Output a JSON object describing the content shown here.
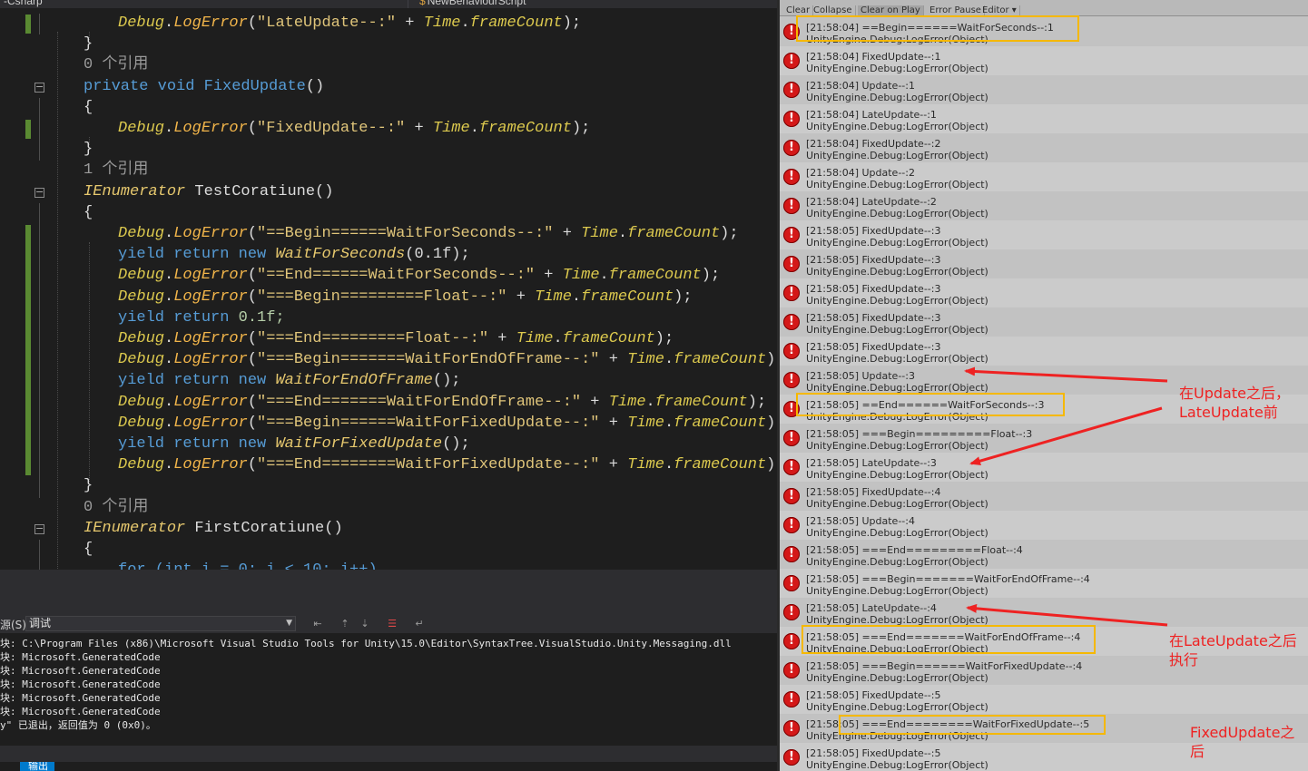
{
  "editor": {
    "tabs": [
      {
        "label": "-Csharp"
      },
      {
        "label": "NewBehaviourScript",
        "glyph": "$"
      }
    ],
    "lines": [
      {
        "kind": "call",
        "str": "\"LateUpdate--:\""
      },
      {
        "kind": "close"
      },
      {
        "kind": "ref",
        "text": "0 个引用"
      },
      {
        "kind": "sig",
        "mod": "private void",
        "name": "FixedUpdate",
        "rest": "()"
      },
      {
        "kind": "open"
      },
      {
        "kind": "call",
        "str": "\"FixedUpdate--:\""
      },
      {
        "kind": "close"
      },
      {
        "kind": "ref",
        "text": "1 个引用"
      },
      {
        "kind": "sig",
        "type": "IEnumerator",
        "name": "TestCoratiune",
        "rest": "()"
      },
      {
        "kind": "open"
      },
      {
        "kind": "call",
        "str": "\"==Begin======WaitForSeconds--:\""
      },
      {
        "kind": "yield",
        "kw": "yield return new",
        "type": "WaitForSeconds",
        "arg": "(0.1f);"
      },
      {
        "kind": "call",
        "str": "\"==End======WaitForSeconds--:\""
      },
      {
        "kind": "call",
        "str": "\"===Begin=========Float--:\""
      },
      {
        "kind": "yieldval",
        "kw": "yield return",
        "val": "0.1f;"
      },
      {
        "kind": "call",
        "str": "\"===End=========Float--:\""
      },
      {
        "kind": "call",
        "str": "\"===Begin=======WaitForEndOfFrame--:\""
      },
      {
        "kind": "yield",
        "kw": "yield return new",
        "type": "WaitForEndOfFrame",
        "arg": "();"
      },
      {
        "kind": "call",
        "str": "\"===End=======WaitForEndOfFrame--:\""
      },
      {
        "kind": "call",
        "str": "\"===Begin======WaitForFixedUpdate--:\""
      },
      {
        "kind": "yield",
        "kw": "yield return new",
        "type": "WaitForFixedUpdate",
        "arg": "();"
      },
      {
        "kind": "call",
        "str": "\"===End========WaitForFixedUpdate--:\""
      },
      {
        "kind": "close"
      },
      {
        "kind": "ref",
        "text": "0 个引用"
      },
      {
        "kind": "sig",
        "type": "IEnumerator",
        "name": "FirstCoratiune",
        "rest": "()"
      },
      {
        "kind": "open"
      },
      {
        "kind": "for",
        "text": "for (int i = 0; i < 10; i++)"
      }
    ],
    "tokens": {
      "debug": "Debug",
      "logerror": "LogError",
      "time": "Time",
      "framecount": "frameCount",
      "plus": " + ",
      "tail": ");",
      "open_brace": "{",
      "close_brace": "}"
    }
  },
  "output": {
    "source_label": "源(S):",
    "source_value": "调试",
    "lines": [
      "块: C:\\Program Files (x86)\\Microsoft Visual Studio Tools for Unity\\15.0\\Editor\\SyntaxTree.VisualStudio.Unity.Messaging.dll",
      "块: Microsoft.GeneratedCode",
      "块: Microsoft.GeneratedCode",
      "块: Microsoft.GeneratedCode",
      "块: Microsoft.GeneratedCode",
      "块: Microsoft.GeneratedCode",
      "y\" 已退出，返回值为 0 (0x0)。"
    ],
    "bottom_tab": "输出"
  },
  "console": {
    "toolbar": [
      {
        "label": "Clear",
        "active": false
      },
      {
        "label": "Collapse",
        "active": false
      },
      {
        "label": "Clear on Play",
        "active": true
      },
      {
        "label": "Error Pause",
        "active": false
      },
      {
        "label": "Editor ▾",
        "active": false
      }
    ],
    "error_glyph": "!",
    "source_line": "UnityEngine.Debug:LogError(Object)",
    "entries": [
      "[21:58:04] ==Begin======WaitForSeconds--:1",
      "[21:58:04] FixedUpdate--:1",
      "[21:58:04] Update--:1",
      "[21:58:04] LateUpdate--:1",
      "[21:58:04] FixedUpdate--:2",
      "[21:58:04] Update--:2",
      "[21:58:04] LateUpdate--:2",
      "[21:58:05] FixedUpdate--:3",
      "[21:58:05] FixedUpdate--:3",
      "[21:58:05] FixedUpdate--:3",
      "[21:58:05] FixedUpdate--:3",
      "[21:58:05] FixedUpdate--:3",
      "[21:58:05] Update--:3",
      "[21:58:05] ==End======WaitForSeconds--:3",
      "[21:58:05] ===Begin=========Float--:3",
      "[21:58:05] LateUpdate--:3",
      "[21:58:05] FixedUpdate--:4",
      "[21:58:05] Update--:4",
      "[21:58:05] ===End=========Float--:4",
      "[21:58:05] ===Begin=======WaitForEndOfFrame--:4",
      "[21:58:05] LateUpdate--:4",
      "[21:58:05] ===End=======WaitForEndOfFrame--:4",
      "[21:58:05] ===Begin======WaitForFixedUpdate--:4",
      "[21:58:05] FixedUpdate--:5",
      "[21:58:05] ===End========WaitForFixedUpdate--:5",
      "[21:58:05] FixedUpdate--:5"
    ]
  },
  "annotations": {
    "note1": [
      "在Update之后，",
      "LateUpdate前"
    ],
    "note2": [
      "在LateUpdate之后",
      "执行"
    ],
    "note3": [
      "FixedUpdate之",
      "后"
    ],
    "highlight_color": "#f5b800",
    "arrow_color": "#ee2222"
  }
}
